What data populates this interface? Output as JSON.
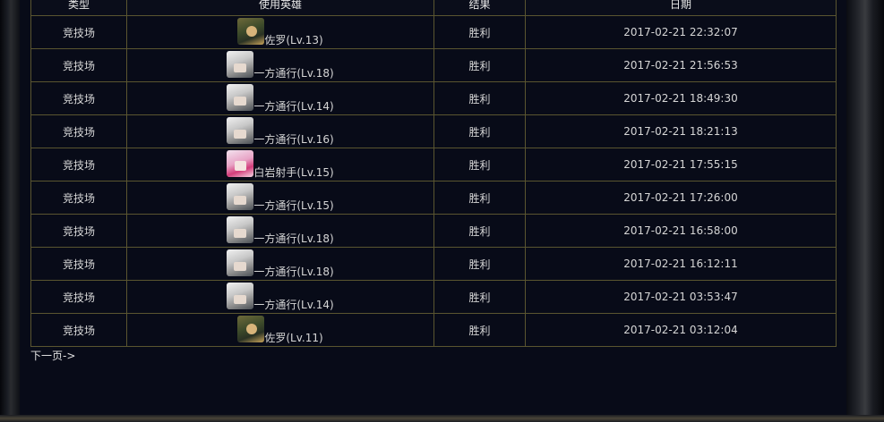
{
  "table": {
    "headers": [
      "类型",
      "使用英雄",
      "结果",
      "日期"
    ],
    "rows": [
      {
        "type": "竞技场",
        "avatar": "zorro-avatar",
        "hero": "佐罗(Lv.13)",
        "result": "胜利",
        "date": "2017-02-21 22:32:07"
      },
      {
        "type": "竞技场",
        "avatar": "accelerator-avatar",
        "hero": "一方通行(Lv.18)",
        "result": "胜利",
        "date": "2017-02-21 21:56:53"
      },
      {
        "type": "竞技场",
        "avatar": "accelerator-avatar",
        "hero": "一方通行(Lv.14)",
        "result": "胜利",
        "date": "2017-02-21 18:49:30"
      },
      {
        "type": "竞技场",
        "avatar": "accelerator-avatar",
        "hero": "一方通行(Lv.16)",
        "result": "胜利",
        "date": "2017-02-21 18:21:13"
      },
      {
        "type": "竞技场",
        "avatar": "black-rock-shooter-avatar",
        "hero": "白岩射手(Lv.15)",
        "result": "胜利",
        "date": "2017-02-21 17:55:15"
      },
      {
        "type": "竞技场",
        "avatar": "accelerator-avatar",
        "hero": "一方通行(Lv.15)",
        "result": "胜利",
        "date": "2017-02-21 17:26:00"
      },
      {
        "type": "竞技场",
        "avatar": "accelerator-avatar",
        "hero": "一方通行(Lv.18)",
        "result": "胜利",
        "date": "2017-02-21 16:58:00"
      },
      {
        "type": "竞技场",
        "avatar": "accelerator-avatar",
        "hero": "一方通行(Lv.18)",
        "result": "胜利",
        "date": "2017-02-21 16:12:11"
      },
      {
        "type": "竞技场",
        "avatar": "accelerator-avatar",
        "hero": "一方通行(Lv.14)",
        "result": "胜利",
        "date": "2017-02-21 03:53:47"
      },
      {
        "type": "竞技场",
        "avatar": "zorro-avatar",
        "hero": "佐罗(Lv.11)",
        "result": "胜利",
        "date": "2017-02-21 03:12:04"
      }
    ]
  },
  "pagination": {
    "next_label": "下一页->"
  },
  "colors": {
    "border": "#5a5530",
    "background": "#080b18",
    "text": "#d6d6d6"
  }
}
